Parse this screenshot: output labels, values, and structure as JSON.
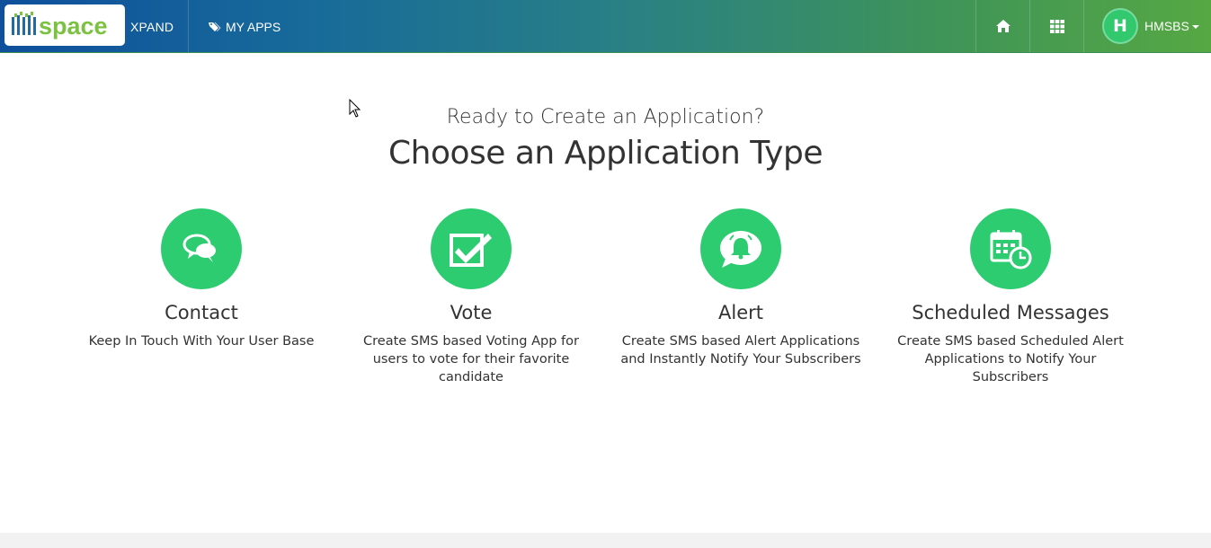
{
  "header": {
    "logo_text": "mspace",
    "brand_suffix": "XPAND",
    "nav_my_apps": "MY APPS",
    "home_icon": "home-icon",
    "apps_icon": "grid-icon",
    "user": {
      "initial": "H",
      "name": "HMSBS"
    },
    "colors": {
      "gradient_start": "#0f4f9c",
      "gradient_end": "#56a843"
    }
  },
  "main": {
    "subtitle": "Ready to Create an Application?",
    "title": "Choose an Application Type",
    "accent_color": "#2ecc71",
    "app_types": [
      {
        "icon": "chat-bubbles-icon",
        "title": "Contact",
        "description": "Keep In Touch With Your User Base"
      },
      {
        "icon": "checkbox-icon",
        "title": "Vote",
        "description": "Create SMS based Voting App for users to vote for their favorite candidate"
      },
      {
        "icon": "bell-alert-icon",
        "title": "Alert",
        "description": "Create SMS based Alert Applications and Instantly Notify Your Subscribers"
      },
      {
        "icon": "calendar-clock-icon",
        "title": "Scheduled Messages",
        "description": "Create SMS based Scheduled Alert Applications to Notify Your Subscribers"
      }
    ]
  }
}
